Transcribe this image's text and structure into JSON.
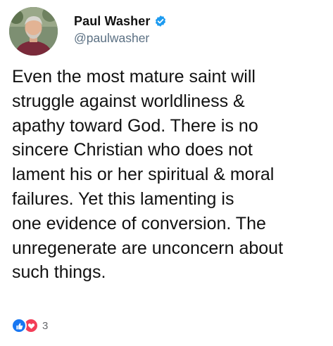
{
  "author": {
    "display_name": "Paul Washer",
    "handle": "@paulwasher",
    "verified_icon": "verified-badge-icon",
    "avatar_icon": "profile-photo"
  },
  "tweet": {
    "text": "Even the most mature saint will\nstruggle against worldliness &\napathy toward God. There is no\nsincere Christian who does not\nlament his or her spiritual & moral\nfailures. Yet this lamenting is\none evidence of conversion. The\nunregenerate are unconcern about\nsuch things."
  },
  "reactions": {
    "icons": [
      "like-reaction-icon",
      "love-reaction-icon"
    ],
    "count": "3"
  },
  "colors": {
    "verified_blue": "#1d9bf0",
    "handle_gray": "#5b7083",
    "like_blue": "#1877f2",
    "love_red": "#f33e58"
  }
}
